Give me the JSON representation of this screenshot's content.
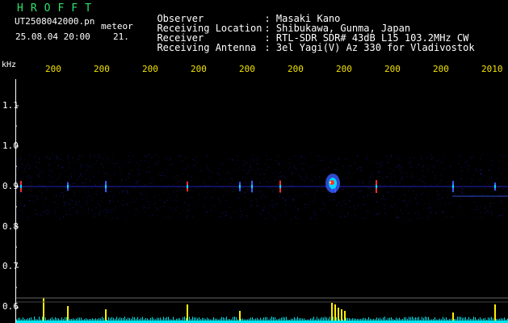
{
  "header": {
    "title": "HROFFT",
    "filename": "UT2508042000.pn",
    "meteor_label": "meteor",
    "date_time": "25.08.04 20:00",
    "count": "21."
  },
  "info": [
    {
      "label": "Observer",
      "value": ": Masaki Kano"
    },
    {
      "label": "Receiving Location",
      "value": ": Shibukawa, Gunma, Japan"
    },
    {
      "label": "Receiver",
      "value": ": RTL-SDR SDR# 43dB L15 103.2MHz CW"
    },
    {
      "label": "Receiving Antenna",
      "value": ": 3el Yagi(V) Az 330 for Vladivostok"
    }
  ],
  "chart_data": {
    "type": "heatmap",
    "ylabel": "kHz",
    "x_tick_labels": [
      "200",
      "200",
      "200",
      "200",
      "200",
      "200",
      "200",
      "200",
      "200",
      "2010"
    ],
    "y_tick_labels": [
      "1.1",
      "1.0",
      "0.9",
      "0.8",
      "0.7",
      "0.6"
    ],
    "y_ticks": [
      1.1,
      1.0,
      0.9,
      0.8,
      0.7,
      0.6
    ],
    "ylim": [
      0.58,
      1.15
    ],
    "noise_band_khz": [
      0.82,
      0.98
    ],
    "carrier_khz": 0.9,
    "colors": {
      "background": "#000000",
      "noise": "#1a1a9c",
      "signal_low": "#3a5cff",
      "signal_mid": "#00d8ff",
      "signal_high": "#ff3030",
      "signal_core": "#ffff40",
      "activity_base": "#00e6f0",
      "activity_peak": "#ffee00",
      "x_ticks": "#f2e200"
    }
  }
}
